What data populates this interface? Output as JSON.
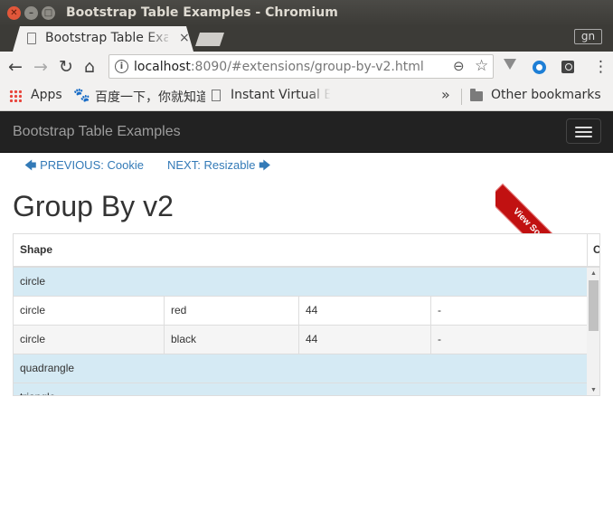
{
  "window": {
    "title": "Bootstrap Table Examples - Chromium",
    "close_glyph": "✕",
    "min_glyph": "–",
    "max_glyph": "□"
  },
  "tabs": [
    {
      "title": "Bootstrap Table Examples",
      "close_glyph": "×"
    }
  ],
  "profile": {
    "label": "gn"
  },
  "toolbar": {
    "back_glyph": "←",
    "forward_glyph": "→",
    "reload_glyph": "↻",
    "home_glyph": "⌂",
    "url_host": "localhost",
    "url_rest": ":8090/#extensions/group-by-v2.html",
    "info_glyph": "i",
    "zoom_glyph": "⊖",
    "star_glyph": "☆",
    "menu_glyph": "⋮",
    "extension_icons": [
      "vue-devtools-icon",
      "blue-extension-icon",
      "dark-extension-icon"
    ]
  },
  "bookmarks": {
    "items": [
      {
        "label": "Apps",
        "icon": "apps-grid-icon"
      },
      {
        "label": "百度一下，你就知道",
        "icon": "paw-icon"
      },
      {
        "label": "Instant Virtual E",
        "icon": "page-icon"
      }
    ],
    "overflow_glyph": "»",
    "other_label": "Other bookmarks"
  },
  "page": {
    "brand": "Bootstrap Table Examples",
    "prev_arrow": "🡄",
    "prev_label": "PREVIOUS: Cookie",
    "next_label": "NEXT: Resizable",
    "next_arrow": "🡆",
    "title": "Group By v2",
    "ribbon": "View Source on GitHub"
  },
  "table": {
    "header_shape": "Shape",
    "header_extra": "C",
    "rows": [
      {
        "type": "group",
        "label": "circle"
      },
      {
        "type": "data",
        "cells": [
          "circle",
          "red",
          "44",
          "-"
        ]
      },
      {
        "type": "data",
        "cells": [
          "circle",
          "black",
          "44",
          "-"
        ]
      },
      {
        "type": "group",
        "label": "quadrangle"
      },
      {
        "type": "group",
        "label": "triangle"
      }
    ],
    "scroll_up_glyph": "▲",
    "scroll_down_glyph": "▼"
  }
}
